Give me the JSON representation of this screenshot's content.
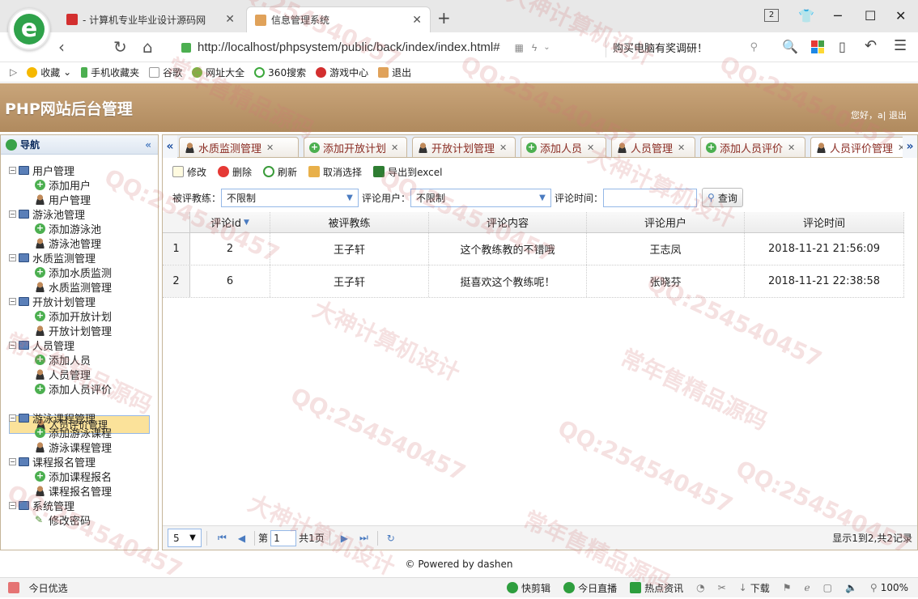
{
  "browser": {
    "tabs": [
      {
        "label": "- 计算机专业毕业设计源码网"
      },
      {
        "label": "信息管理系统"
      }
    ],
    "tab_count": "2",
    "new_tab": "+",
    "url": "http://localhost/phpsystem/public/back/index/index.html#",
    "search_text": "购买电脑有奖调研！",
    "bookmarks": [
      "收藏",
      "手机收藏夹",
      "谷歌",
      "网址大全",
      "360搜索",
      "游戏中心",
      "退出"
    ]
  },
  "app": {
    "title": "PHP网站后台管理",
    "user_line": "您好，a| 退出"
  },
  "nav": {
    "title": "导航",
    "groups": [
      {
        "label": "用户管理",
        "items": [
          "添加用户",
          "用户管理"
        ]
      },
      {
        "label": "游泳池管理",
        "items": [
          "添加游泳池",
          "游泳池管理"
        ]
      },
      {
        "label": "水质监测管理",
        "items": [
          "添加水质监测",
          "水质监测管理"
        ]
      },
      {
        "label": "开放计划管理",
        "items": [
          "添加开放计划",
          "开放计划管理"
        ]
      },
      {
        "label": "人员管理",
        "items": [
          "添加人员",
          "人员管理",
          "添加人员评价",
          "人员评价管理"
        ]
      },
      {
        "label": "游泳课程管理",
        "items": [
          "添加游泳课程",
          "游泳课程管理"
        ]
      },
      {
        "label": "课程报名管理",
        "items": [
          "添加课程报名",
          "课程报名管理"
        ]
      },
      {
        "label": "系统管理",
        "items": [
          "修改密码"
        ]
      }
    ],
    "selected": "人员评价管理"
  },
  "tabs": [
    "水质监测管理",
    "添加开放计划",
    "开放计划管理",
    "添加人员",
    "人员管理",
    "添加人员评价",
    "人员评价管理"
  ],
  "toolbar": {
    "edit": "修改",
    "delete": "删除",
    "refresh": "刷新",
    "cancel_select": "取消选择",
    "export": "导出到excel"
  },
  "filters": {
    "coach_label": "被评教练：",
    "coach_value": "不限制",
    "user_label": "评论用户：",
    "user_value": "不限制",
    "time_label": "评论时间：",
    "time_value": "",
    "query": "查询"
  },
  "grid": {
    "columns": [
      "评论id",
      "被评教练",
      "评论内容",
      "评论用户",
      "评论时间"
    ],
    "rows": [
      {
        "rn": "1",
        "id": "2",
        "coach": "王子轩",
        "content": "这个教练教的不错哦",
        "user": "王志凤",
        "time": "2018-11-21 21:56:09"
      },
      {
        "rn": "2",
        "id": "6",
        "coach": "王子轩",
        "content": "挺喜欢这个教练呢！",
        "user": "张晓芬",
        "time": "2018-11-21 22:38:58"
      }
    ]
  },
  "pager": {
    "page_size": "5",
    "page_prefix": "第",
    "page_value": "1",
    "page_total": "共1页",
    "summary": "显示1到2,共2记录"
  },
  "footer": "© Powered by dashen",
  "statusbar": {
    "left": "今日优选",
    "items": [
      "快剪辑",
      "今日直播",
      "热点资讯",
      "下载"
    ],
    "zoom": "100%"
  },
  "watermarks": [
    "QQ:254540457",
    "常年售精品源码",
    "大神计算机设计"
  ]
}
